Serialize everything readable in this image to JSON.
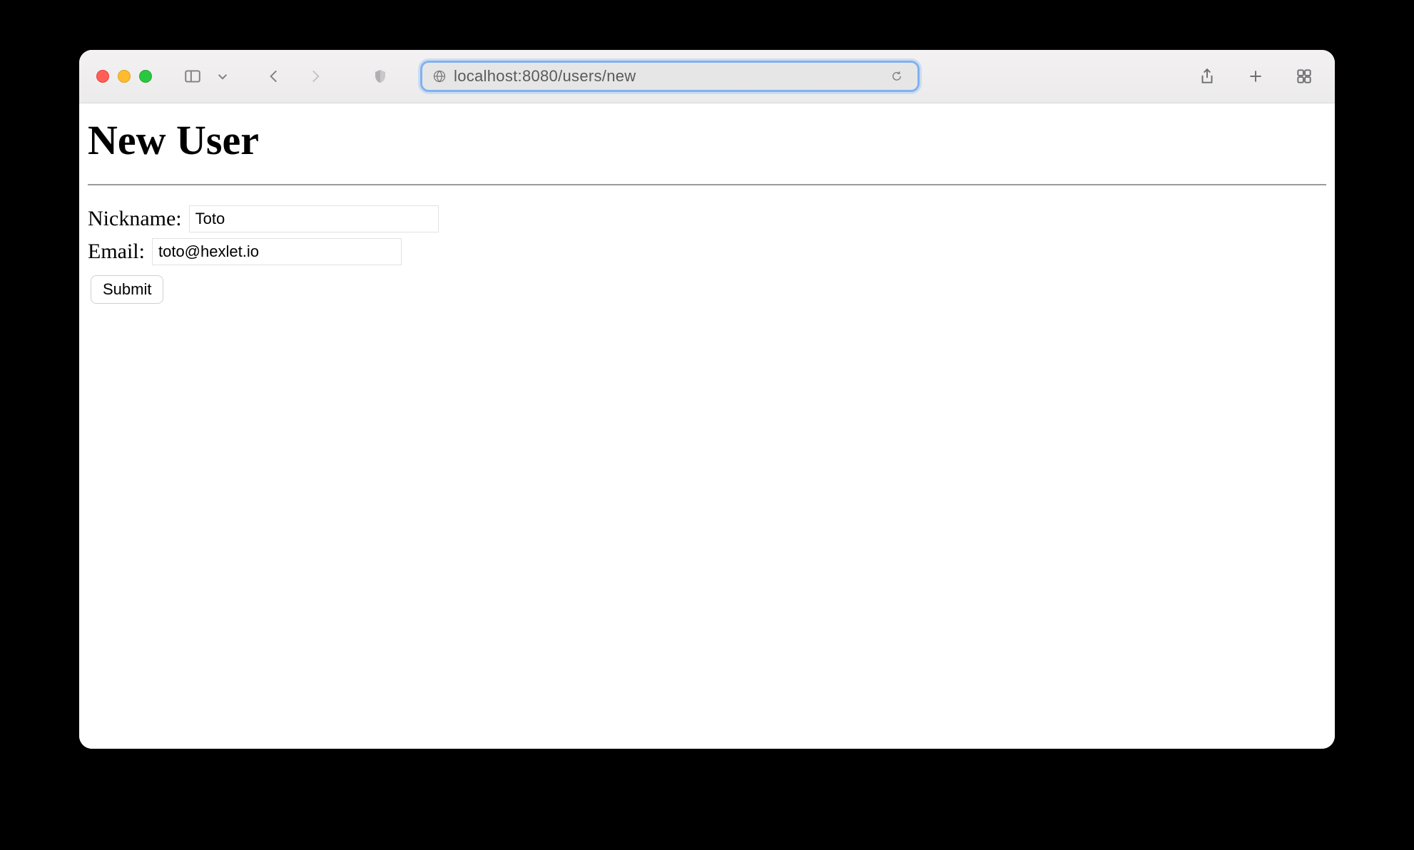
{
  "browser": {
    "url": "localhost:8080/users/new"
  },
  "page": {
    "title": "New User",
    "form": {
      "nickname_label": "Nickname:",
      "nickname_value": "Toto",
      "email_label": "Email:",
      "email_value": "toto@hexlet.io",
      "submit_label": "Submit"
    }
  }
}
